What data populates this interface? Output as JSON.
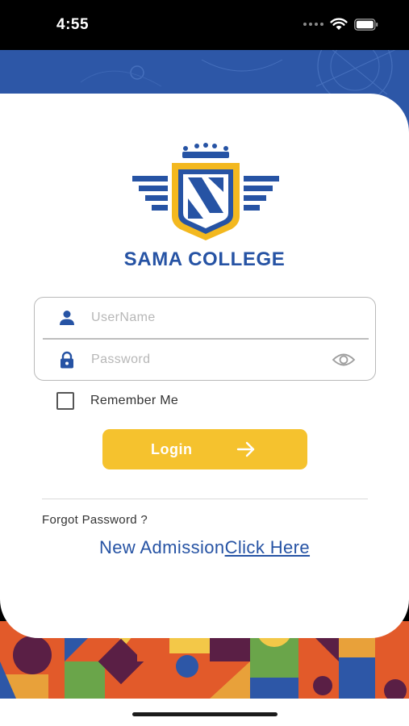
{
  "status_bar": {
    "time": "4:55"
  },
  "brand": {
    "name": "SAMA COLLEGE"
  },
  "form": {
    "username": {
      "value": "",
      "placeholder": "UserName"
    },
    "password": {
      "value": "",
      "placeholder": "Password"
    },
    "remember_label": "Remember Me",
    "remember_checked": false,
    "login_label": "Login"
  },
  "links": {
    "forgot_password": "Forgot Password ?",
    "new_admission": "New Admission",
    "click_here": "Click Here"
  },
  "colors": {
    "brand_blue": "#2653a4",
    "accent_yellow": "#f5c22e",
    "band_blue": "#2d57a7",
    "pattern_orange": "#e25a2a",
    "pattern_purple": "#5a1f45",
    "pattern_green": "#6aa54a"
  }
}
